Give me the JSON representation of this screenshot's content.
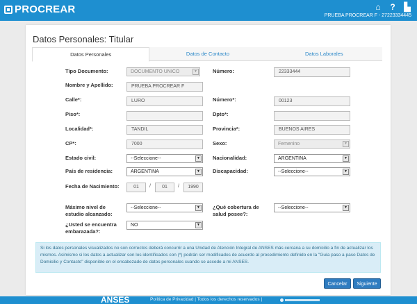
{
  "header": {
    "logo_text": "PROCREAR",
    "user_label": "PRUEBA PROCREAR F - 27223334445",
    "icons": [
      "home-icon",
      "help-icon",
      "menu-icon"
    ]
  },
  "page": {
    "title": "Datos Personales: Titular"
  },
  "tabs": [
    {
      "label": "Datos Personales",
      "active": true
    },
    {
      "label": "Datos de Contacto",
      "active": false
    },
    {
      "label": "Datos Laborales",
      "active": false
    }
  ],
  "form": {
    "tipo_documento": {
      "label": "Tipo Documento:",
      "value": "DOCUMENTO UNICO"
    },
    "numero_doc": {
      "label": "Número:",
      "value": "22333444"
    },
    "nombre": {
      "label": "Nombre y Apellido:",
      "value": "PRUEBA PROCREAR F"
    },
    "calle": {
      "label": "Calle*:",
      "value": "LURO"
    },
    "numero_calle": {
      "label": "Número*:",
      "value": "00123"
    },
    "piso": {
      "label": "Piso*:",
      "value": ""
    },
    "dpto": {
      "label": "Dpto*:",
      "value": ""
    },
    "localidad": {
      "label": "Localidad*:",
      "value": "TANDIL"
    },
    "provincia": {
      "label": "Provincia*:",
      "value": "BUENOS AIRES"
    },
    "cp": {
      "label": "CP*:",
      "value": "7000"
    },
    "sexo": {
      "label": "Sexo:",
      "value": "Femenino"
    },
    "estado_civil": {
      "label": "Estado civil:",
      "value": "--Seleccione--"
    },
    "nacionalidad": {
      "label": "Nacionalidad:",
      "value": "ARGENTINA"
    },
    "pais": {
      "label": "País de residencia:",
      "value": "ARGENTINA"
    },
    "discapacidad": {
      "label": "Discapacidad:",
      "value": "--Seleccione--"
    },
    "nacimiento": {
      "label": "Fecha de Nacimiento:",
      "day": "01",
      "month": "01",
      "year": "1990",
      "sep": "/"
    },
    "estudios": {
      "label_1": "Máximo nivel de",
      "label_2": "estudio alcanzado:",
      "value": "--Seleccione--"
    },
    "cobertura": {
      "label_1": "¿Qué cobertura de",
      "label_2": "salud posee?:",
      "value": "--Seleccione--"
    },
    "embarazada": {
      "label_1": "¿Usted se encuentra",
      "label_2": "embarazada?:",
      "value": "NO"
    }
  },
  "info": {
    "text": "Si los datos personales visualizados no son correctos deberá concurrir a una Unidad de Atención Integral de ANSES más cercana a su domicilio a fin de actualizar los mismos. Asimismo si los datos a actualizar son los identificados con (*) podrán ser modificados de acuerdo al procedimiento definido en la \"Guía paso a paso Datos de Domicilio y Contacto\" disponible en el encabezado de datos personales cuando se accede a mi ANSES."
  },
  "buttons": {
    "cancel": "Cancelar",
    "next": "Siguiente"
  },
  "footer": {
    "logo": "ANSES",
    "links": "Política de Privacidad | Todos los derechos reservados |"
  },
  "colors": {
    "brand": "#1e8fd0",
    "button": "#2e7cc0",
    "info_bg": "#d9edf7",
    "info_text": "#31708f"
  }
}
